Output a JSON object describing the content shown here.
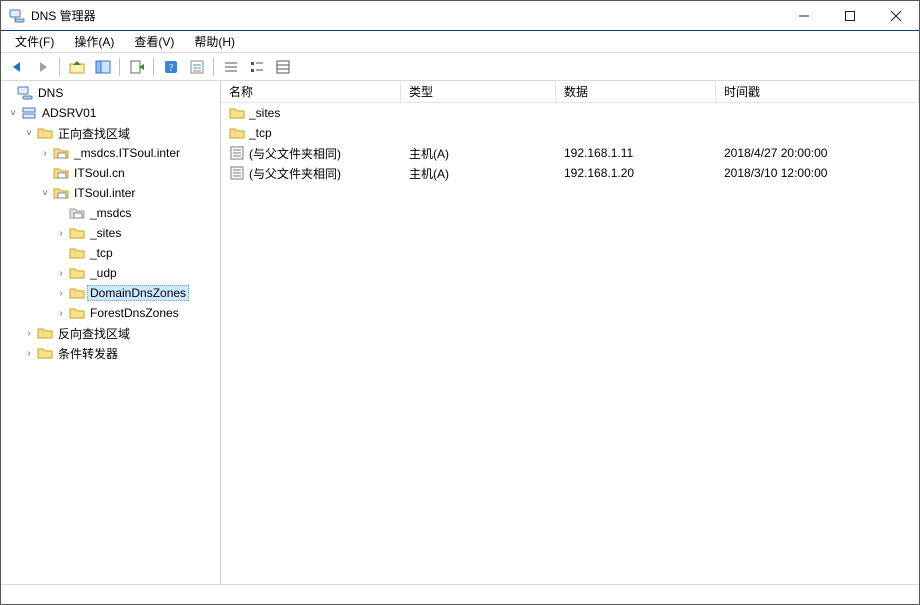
{
  "window": {
    "title": "DNS 管理器"
  },
  "menu": {
    "file": "文件(F)",
    "action": "操作(A)",
    "view": "查看(V)",
    "help": "帮助(H)"
  },
  "toolbar": {
    "back": "back-arrow",
    "forward": "forward-arrow",
    "up": "up-folder",
    "show_hide_tree": "show-hide-tree",
    "export": "export-list",
    "help": "help",
    "props": "properties",
    "list1": "list-small",
    "list2": "list-large",
    "list3": "list-detail"
  },
  "tree": {
    "root_label": "DNS",
    "server_label": "ADSRV01",
    "fwd_zone_label": "正向查找区域",
    "zone_msdcs": "_msdcs.ITSoul.inter",
    "zone_itsoul_cn": "ITSoul.cn",
    "zone_itsoul_inter": "ITSoul.inter",
    "sub_msdcs": "_msdcs",
    "sub_sites": "_sites",
    "sub_tcp": "_tcp",
    "sub_udp": "_udp",
    "sub_domain_dz": "DomainDnsZones",
    "sub_forest_dz": "ForestDnsZones",
    "rev_zone_label": "反向查找区域",
    "cond_fwd_label": "条件转发器"
  },
  "columns": {
    "name": "名称",
    "type": "类型",
    "data": "数据",
    "timestamp": "时间戳"
  },
  "rows": [
    {
      "icon": "folder",
      "name": "_sites",
      "type": "",
      "data": "",
      "ts": ""
    },
    {
      "icon": "folder",
      "name": "_tcp",
      "type": "",
      "data": "",
      "ts": ""
    },
    {
      "icon": "record",
      "name": "(与父文件夹相同)",
      "type": "主机(A)",
      "data": "192.168.1.11",
      "ts": "2018/4/27 20:00:00"
    },
    {
      "icon": "record",
      "name": "(与父文件夹相同)",
      "type": "主机(A)",
      "data": "192.168.1.20",
      "ts": "2018/3/10 12:00:00"
    }
  ]
}
